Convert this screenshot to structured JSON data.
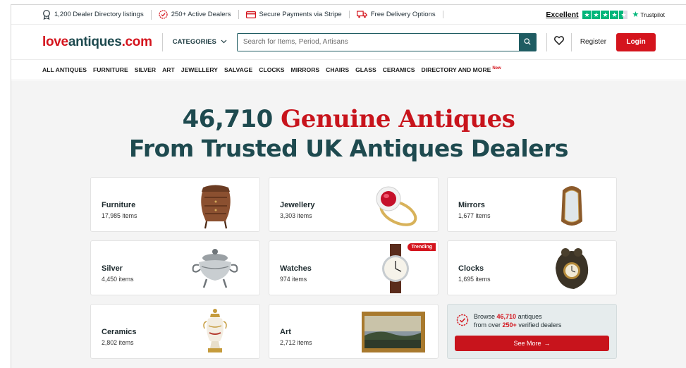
{
  "trustbar": {
    "listings": "1,200 Dealer Directory listings",
    "dealers": "250+ Active Dealers",
    "payments": "Secure Payments via Stripe",
    "delivery": "Free Delivery Options",
    "rating_word": "Excellent",
    "trustpilot": "Trustpilot"
  },
  "header": {
    "logo_part1": "love",
    "logo_part2": "antiques",
    "logo_part3": ".com",
    "categories_label": "CATEGORIES",
    "search_placeholder": "Search for Items, Period, Artisans",
    "register_label": "Register",
    "login_label": "Login"
  },
  "nav": {
    "items": [
      "ALL ANTIQUES",
      "FURNITURE",
      "SILVER",
      "ART",
      "JEWELLERY",
      "SALVAGE",
      "CLOCKS",
      "MIRRORS",
      "CHAIRS",
      "GLASS",
      "CERAMICS",
      "DIRECTORY AND MORE"
    ],
    "new_tag": "New"
  },
  "hero": {
    "count": "46,710",
    "highlight": "Genuine Antiques",
    "line2": "From Trusted UK Antiques Dealers"
  },
  "categories": [
    {
      "name": "Furniture",
      "count": "17,985 items"
    },
    {
      "name": "Jewellery",
      "count": "3,303 items"
    },
    {
      "name": "Mirrors",
      "count": "1,677 items"
    },
    {
      "name": "Silver",
      "count": "4,450 items"
    },
    {
      "name": "Watches",
      "count": "974 items",
      "tag": "Trending"
    },
    {
      "name": "Clocks",
      "count": "1,695 items"
    },
    {
      "name": "Ceramics",
      "count": "2,802 items"
    },
    {
      "name": "Art",
      "count": "2,712 items"
    }
  ],
  "promo": {
    "browse": "Browse",
    "count": "46,710",
    "antiques": "antiques",
    "from_over": "from over",
    "dealers": "250+",
    "verified": "verified dealers",
    "button": "See More"
  },
  "colors": {
    "brand_red": "#d4141d",
    "brand_teal": "#1e4a4f",
    "trustpilot_green": "#00b67a"
  }
}
